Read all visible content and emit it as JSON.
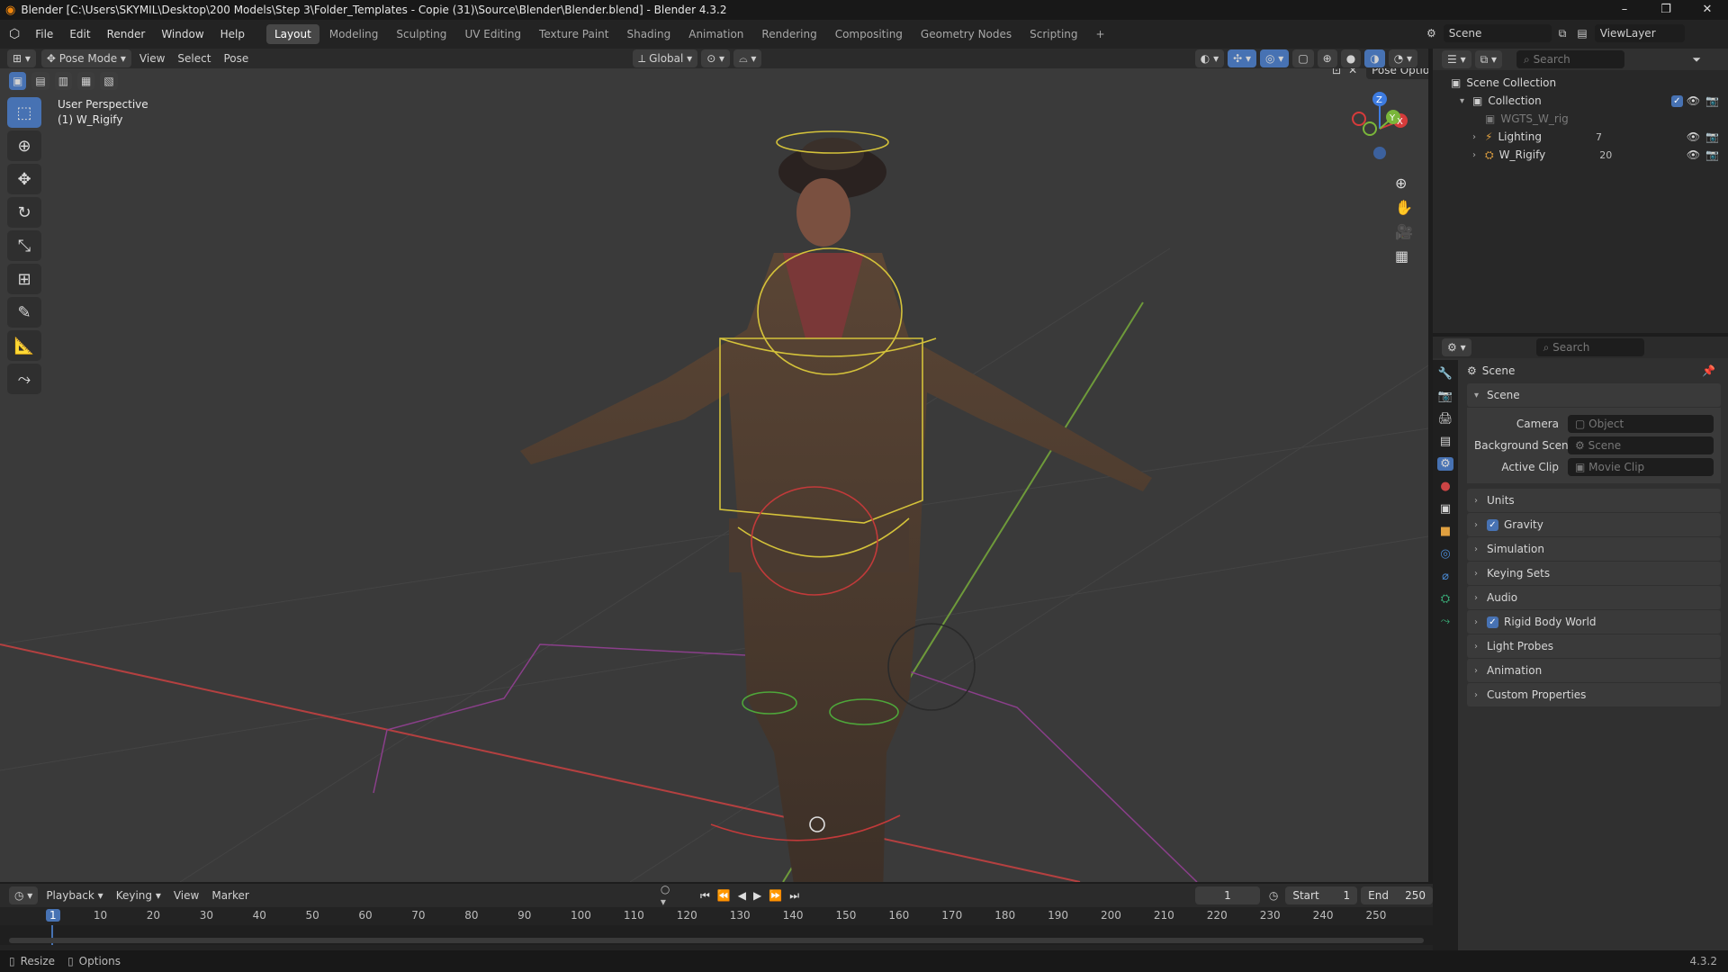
{
  "app": {
    "title": "Blender [C:\\Users\\SKYMIL\\Desktop\\200 Models\\Step 3\\Folder_Templates - Copie (31)\\Source\\Blender\\Blender.blend] - Blender 4.3.2",
    "version": "4.3.2"
  },
  "menu": {
    "items": [
      "File",
      "Edit",
      "Render",
      "Window",
      "Help"
    ]
  },
  "workspaces": [
    "Layout",
    "Modeling",
    "Sculpting",
    "UV Editing",
    "Texture Paint",
    "Shading",
    "Animation",
    "Rendering",
    "Compositing",
    "Geometry Nodes",
    "Scripting",
    "+"
  ],
  "topright": {
    "scene": "Scene",
    "view_layer": "ViewLayer"
  },
  "viewport_header": {
    "mode": "Pose Mode",
    "menus": [
      "View",
      "Select",
      "Pose"
    ],
    "orientation": "Global",
    "pose_options": "Pose Options"
  },
  "viewport": {
    "perspective": "User Perspective",
    "object": "(1) W_Rigify",
    "gizmo": {
      "z": "Z",
      "y": "Y",
      "x": "X"
    }
  },
  "tools": [
    "select-box-icon",
    "cursor-icon",
    "move-icon",
    "rotate-icon",
    "scale-icon",
    "transform-icon",
    "annotate-icon",
    "measure-icon",
    "bone-icon"
  ],
  "outliner": {
    "search_placeholder": "Search",
    "root": "Scene Collection",
    "collection": "Collection",
    "items": [
      {
        "name": "WGTS_W_rig",
        "dim": true
      },
      {
        "name": "Lighting",
        "badge": "7"
      },
      {
        "name": "W_Rigify",
        "badge": "20"
      }
    ]
  },
  "properties": {
    "search_placeholder": "Search",
    "context": "Scene",
    "panel": "Scene",
    "camera_label": "Camera",
    "camera_placeholder": "Object",
    "bg_label": "Background Scene",
    "bg_placeholder": "Scene",
    "clip_label": "Active Clip",
    "clip_placeholder": "Movie Clip",
    "sections": [
      {
        "label": "Units",
        "check": false
      },
      {
        "label": "Gravity",
        "check": true
      },
      {
        "label": "Simulation",
        "check": false
      },
      {
        "label": "Keying Sets",
        "check": false
      },
      {
        "label": "Audio",
        "check": false
      },
      {
        "label": "Rigid Body World",
        "check": true
      },
      {
        "label": "Light Probes",
        "check": false
      },
      {
        "label": "Animation",
        "check": false
      },
      {
        "label": "Custom Properties",
        "check": false
      }
    ]
  },
  "timeline": {
    "menus": [
      "Playback",
      "Keying",
      "View",
      "Marker"
    ],
    "current_frame": "1",
    "start_label": "Start",
    "start": "1",
    "end_label": "End",
    "end": "250",
    "ticks": [
      "1",
      "10",
      "20",
      "30",
      "40",
      "50",
      "60",
      "70",
      "80",
      "90",
      "100",
      "110",
      "120",
      "130",
      "140",
      "150",
      "160",
      "170",
      "180",
      "190",
      "200",
      "210",
      "220",
      "230",
      "240",
      "250"
    ]
  },
  "status": {
    "left1": "Resize",
    "left2": "Options",
    "right": "4.3.2"
  },
  "colors": {
    "accent": "#4772b3",
    "x_axis": "#d63b3b",
    "y_axis": "#7ab63a",
    "z_axis": "#3d7be0"
  }
}
